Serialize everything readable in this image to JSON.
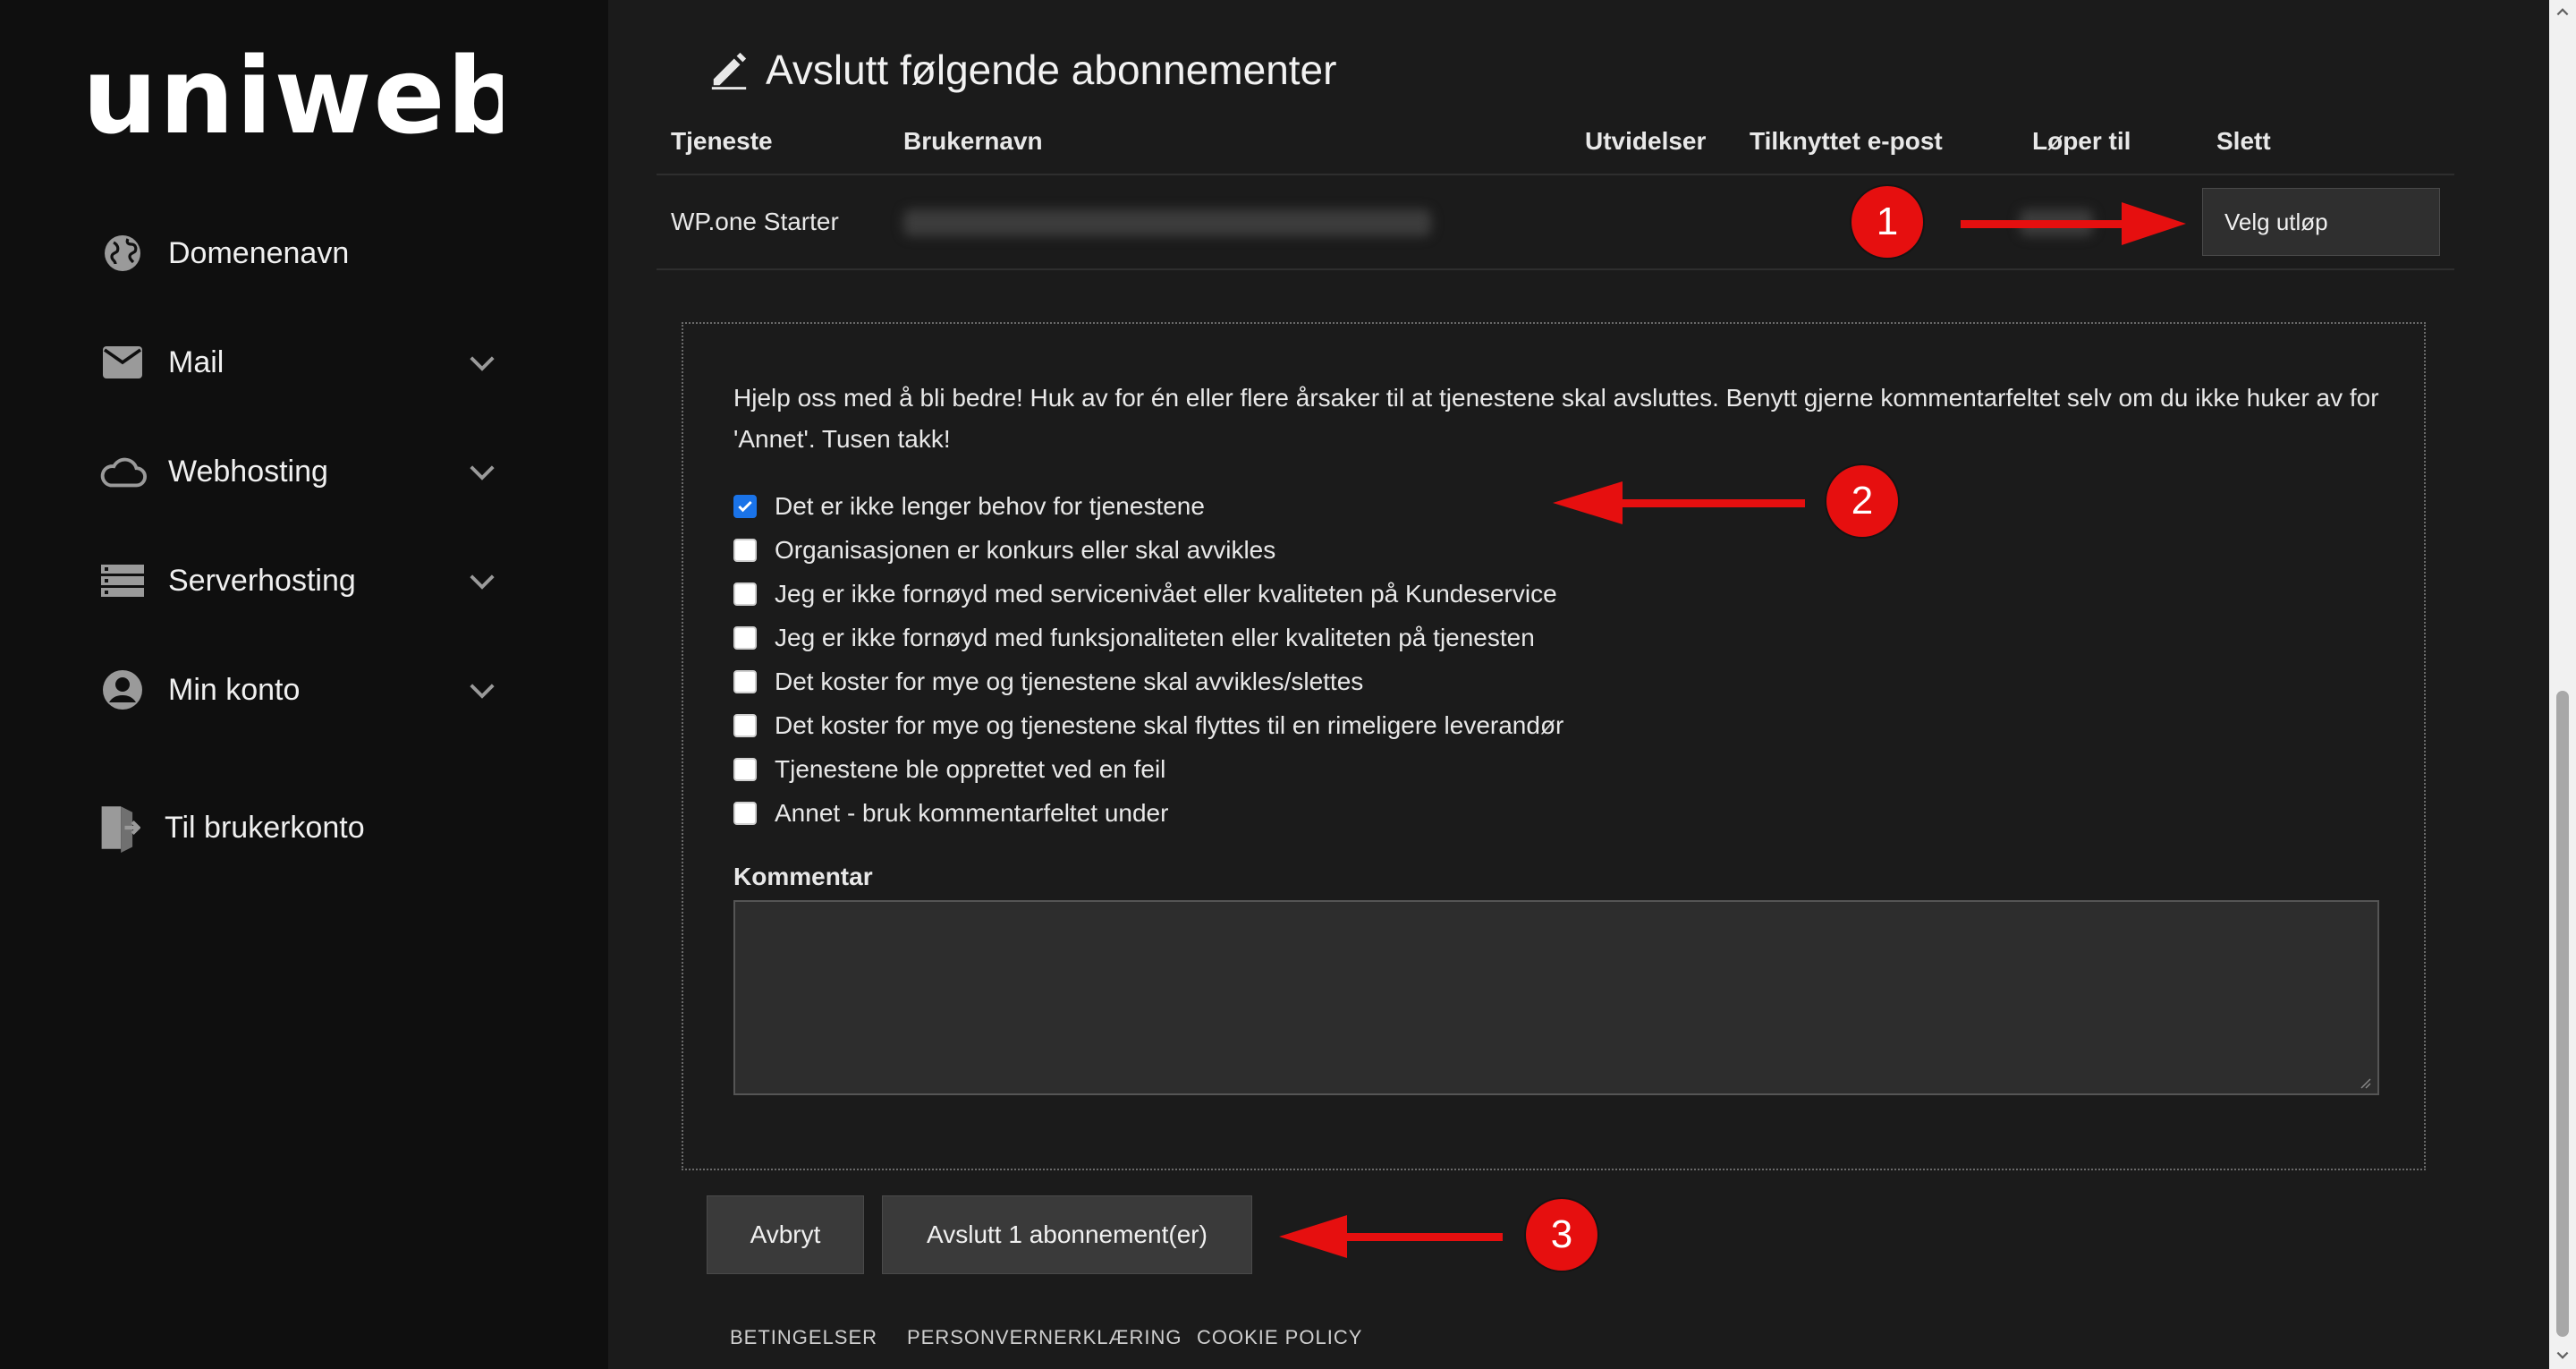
{
  "brand": {
    "logo_text": "uniweb",
    "accent_color": "#e60f0f",
    "checkbox_color": "#1a73e8"
  },
  "sidebar": {
    "items": [
      {
        "label": "Domenenavn",
        "icon": "globe-icon",
        "expandable": false
      },
      {
        "label": "Mail",
        "icon": "mail-icon",
        "expandable": true
      },
      {
        "label": "Webhosting",
        "icon": "cloud-icon",
        "expandable": true
      },
      {
        "label": "Serverhosting",
        "icon": "server-icon",
        "expandable": true
      },
      {
        "label": "Min konto",
        "icon": "account-icon",
        "expandable": true
      }
    ],
    "account_link": {
      "label": "Til brukerkonto",
      "icon": "exit-door-icon"
    }
  },
  "main": {
    "title": "Avslutt følgende abonnementer",
    "table": {
      "headers": [
        "Tjeneste",
        "Brukernavn",
        "Utvidelser",
        "Tilknyttet e-post",
        "Løper til",
        "Slett"
      ],
      "rows": [
        {
          "service": "WP.one Starter",
          "expiry_select": "Velg utløp"
        }
      ]
    },
    "feedback": {
      "intro": "Hjelp oss med å bli bedre! Huk av for én eller flere årsaker til at tjenestene skal avsluttes. Benytt gjerne kommentarfeltet selv om du ikke huker av for 'Annet'. Tusen takk!",
      "reasons": [
        {
          "label": "Det er ikke lenger behov for tjenestene",
          "checked": true
        },
        {
          "label": "Organisasjonen er konkurs eller skal avvikles",
          "checked": false
        },
        {
          "label": "Jeg er ikke fornøyd med servicenivået eller kvaliteten på Kundeservice",
          "checked": false
        },
        {
          "label": "Jeg er ikke fornøyd med funksjonaliteten eller kvaliteten på tjenesten",
          "checked": false
        },
        {
          "label": "Det koster for mye og tjenestene skal avvikles/slettes",
          "checked": false
        },
        {
          "label": "Det koster for mye og tjenestene skal flyttes til en rimeligere leverandør",
          "checked": false
        },
        {
          "label": "Tjenestene ble opprettet ved en feil",
          "checked": false
        },
        {
          "label": "Annet - bruk kommentarfeltet under",
          "checked": false
        }
      ],
      "comment_label": "Kommentar",
      "comment_value": ""
    },
    "buttons": {
      "cancel": "Avbryt",
      "confirm": "Avslutt 1 abonnement(er)"
    }
  },
  "annotations": {
    "step1": "1",
    "step2": "2",
    "step3": "3"
  },
  "footer": {
    "links": [
      "BETINGELSER",
      "PERSONVERNERKLÆRING",
      "COOKIE POLICY"
    ]
  }
}
